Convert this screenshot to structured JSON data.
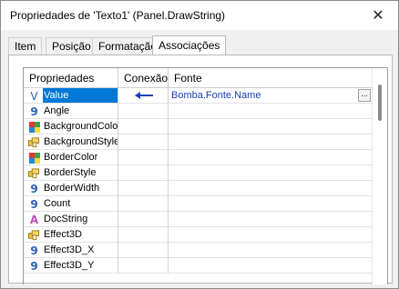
{
  "window": {
    "title": "Propriedades de 'Texto1' (Panel.DrawString)",
    "close_glyph": "✕"
  },
  "tabs": [
    {
      "label": "Item",
      "active": false
    },
    {
      "label": "Posição",
      "active": false
    },
    {
      "label": "Formatação",
      "active": false
    },
    {
      "label": "Associações",
      "active": true
    }
  ],
  "grid": {
    "headers": {
      "properties": "Propriedades",
      "connection": "Conexão",
      "source": "Fonte"
    },
    "rows": [
      {
        "icon": "variant-icon",
        "name": "Value",
        "connection": "arrow-left",
        "source": "Bomba.Fonte.Name",
        "selected": true,
        "source_button": "..."
      },
      {
        "icon": "number-icon",
        "name": "Angle",
        "connection": "",
        "source": ""
      },
      {
        "icon": "color-icon",
        "name": "BackgroundColor",
        "connection": "",
        "source": ""
      },
      {
        "icon": "style-icon",
        "name": "BackgroundStyle",
        "connection": "",
        "source": ""
      },
      {
        "icon": "color-icon",
        "name": "BorderColor",
        "connection": "",
        "source": ""
      },
      {
        "icon": "style-icon",
        "name": "BorderStyle",
        "connection": "",
        "source": ""
      },
      {
        "icon": "number-icon",
        "name": "BorderWidth",
        "connection": "",
        "source": ""
      },
      {
        "icon": "number-icon",
        "name": "Count",
        "connection": "",
        "source": ""
      },
      {
        "icon": "string-icon",
        "name": "DocString",
        "connection": "",
        "source": ""
      },
      {
        "icon": "style-icon",
        "name": "Effect3D",
        "connection": "",
        "source": ""
      },
      {
        "icon": "number-icon",
        "name": "Effect3D_X",
        "connection": "",
        "source": ""
      },
      {
        "icon": "number-icon",
        "name": "Effect3D_Y",
        "connection": "",
        "source": ""
      }
    ]
  },
  "icon_glyphs": {
    "variant-icon": "ᐯ",
    "number-icon": "9",
    "string-icon": "A"
  },
  "colors": {
    "selection": "#0078d7",
    "link_text": "#1a3fb0",
    "number_icon": "#2b5eb5",
    "string_icon": "#c050c0"
  }
}
